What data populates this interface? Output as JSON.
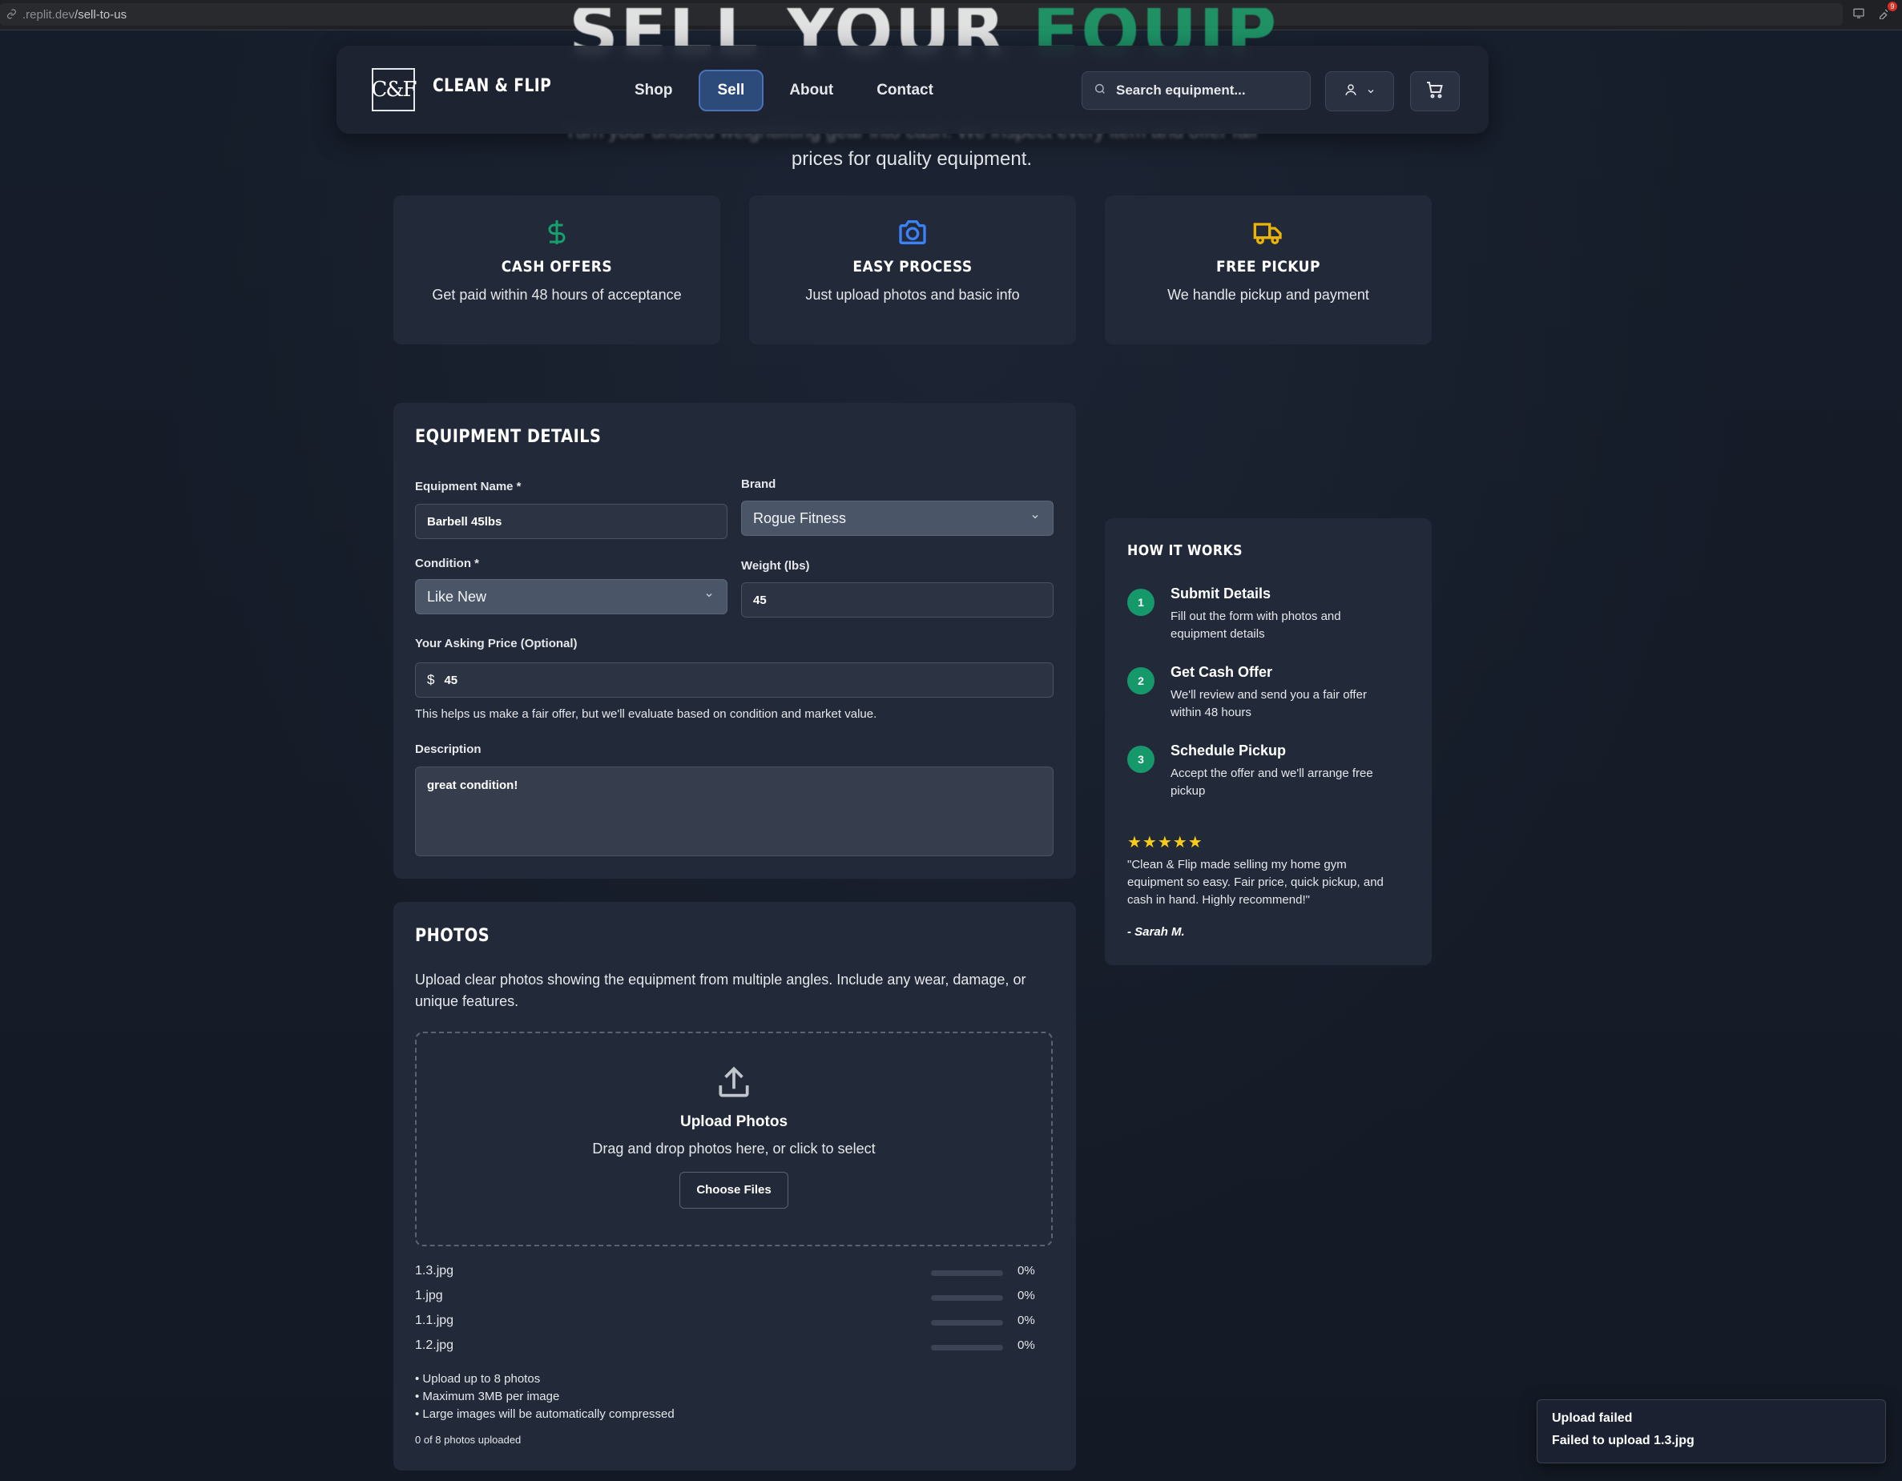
{
  "browser": {
    "url_prefix": ".replit.dev",
    "url_path": "/sell-to-us",
    "notification_count": "9"
  },
  "hero": {
    "title_white": "SELL YOUR ",
    "title_green": "EQUIPMENT",
    "subtitle_line1": "Turn your unused weightlifting gear into cash. We inspect every item and offer fair",
    "subtitle_line2": "prices for quality equipment."
  },
  "nav": {
    "logo": "C&F",
    "brand": "CLEAN & FLIP",
    "links": [
      "Shop",
      "Sell",
      "About",
      "Contact"
    ],
    "active_link": "Sell",
    "search_placeholder": "Search equipment..."
  },
  "features": [
    {
      "icon": "dollar-icon",
      "title": "CASH OFFERS",
      "desc": "Get paid within 48 hours of acceptance",
      "color": "#16a06c"
    },
    {
      "icon": "camera-icon",
      "title": "EASY PROCESS",
      "desc": "Just upload photos and basic info",
      "color": "#3b82f6"
    },
    {
      "icon": "truck-icon",
      "title": "FREE PICKUP",
      "desc": "We handle pickup and payment",
      "color": "#eab308"
    }
  ],
  "equipment": {
    "title": "EQUIPMENT DETAILS",
    "name_label": "Equipment Name *",
    "name_value": "Barbell 45lbs",
    "brand_label": "Brand",
    "brand_value": "Rogue Fitness",
    "condition_label": "Condition *",
    "condition_value": "Like New",
    "weight_label": "Weight (lbs)",
    "weight_value": "45",
    "price_label": "Your Asking Price (Optional)",
    "price_prefix": "$",
    "price_value": "45",
    "price_help": "This helps us make a fair offer, but we'll evaluate based on condition and market value.",
    "desc_label": "Description",
    "desc_value": "great condition!"
  },
  "photos": {
    "title": "PHOTOS",
    "intro_line1": "Upload clear photos showing the equipment from multiple angles. Include any wear, damage, or",
    "intro_line2": "unique features.",
    "drop_title": "Upload Photos",
    "drop_text": "Drag and drop photos here, or click to select",
    "choose_label": "Choose Files",
    "files": [
      {
        "name": "1.3.jpg",
        "progress": 0,
        "pct": "0%"
      },
      {
        "name": "1.jpg",
        "progress": 0,
        "pct": "0%"
      },
      {
        "name": "1.1.jpg",
        "progress": 0,
        "pct": "0%"
      },
      {
        "name": "1.2.jpg",
        "progress": 0,
        "pct": "0%"
      }
    ],
    "notes": [
      "• Upload up to 8 photos",
      "• Maximum 3MB per image",
      "• Large images will be automatically compressed"
    ],
    "counter": "0 of 8 photos uploaded"
  },
  "how": {
    "title": "HOW IT WORKS",
    "steps": [
      {
        "num": "1",
        "title": "Submit Details",
        "desc": "Fill out the form with photos and equipment details"
      },
      {
        "num": "2",
        "title": "Get Cash Offer",
        "desc": "We'll review and send you a fair offer within 48 hours"
      },
      {
        "num": "3",
        "title": "Schedule Pickup",
        "desc": "Accept the offer and we'll arrange free pickup"
      }
    ],
    "stars": "★★★★★",
    "quote": "\"Clean & Flip made selling my home gym equipment so easy. Fair price, quick pickup, and cash in hand. Highly recommend!\"",
    "author": "- Sarah M."
  },
  "toast": {
    "title": "Upload failed",
    "desc": "Failed to upload 1.3.jpg"
  }
}
